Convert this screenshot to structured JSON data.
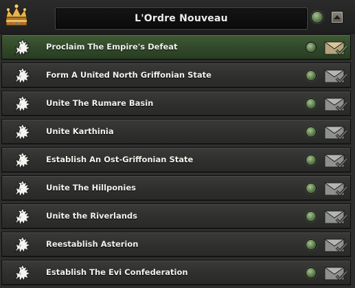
{
  "header": {
    "title": "L'Ordre Nouveau",
    "crown_icon": "crown-icon",
    "status_icon": "status-dot-icon",
    "collapse_icon": "chevron-up-icon"
  },
  "colors": {
    "active_row": "#3a5531",
    "row": "#333432",
    "title_text": "#ececea",
    "status_green": "#6f8f5c",
    "envelope_active": "#b7a37a"
  },
  "decisions": [
    {
      "label": "Proclaim The Empire's Defeat",
      "active": true
    },
    {
      "label": "Form A United North Griffonian State",
      "active": false
    },
    {
      "label": "Unite The Rumare Basin",
      "active": false
    },
    {
      "label": "Unite Karthinia",
      "active": false
    },
    {
      "label": "Establish An Ost-Griffonian State",
      "active": false
    },
    {
      "label": "Unite The Hillponies",
      "active": false
    },
    {
      "label": "Unite the Riverlands",
      "active": false
    },
    {
      "label": "Reestablish Asterion",
      "active": false
    },
    {
      "label": "Establish The Evi Confederation",
      "active": false
    }
  ]
}
